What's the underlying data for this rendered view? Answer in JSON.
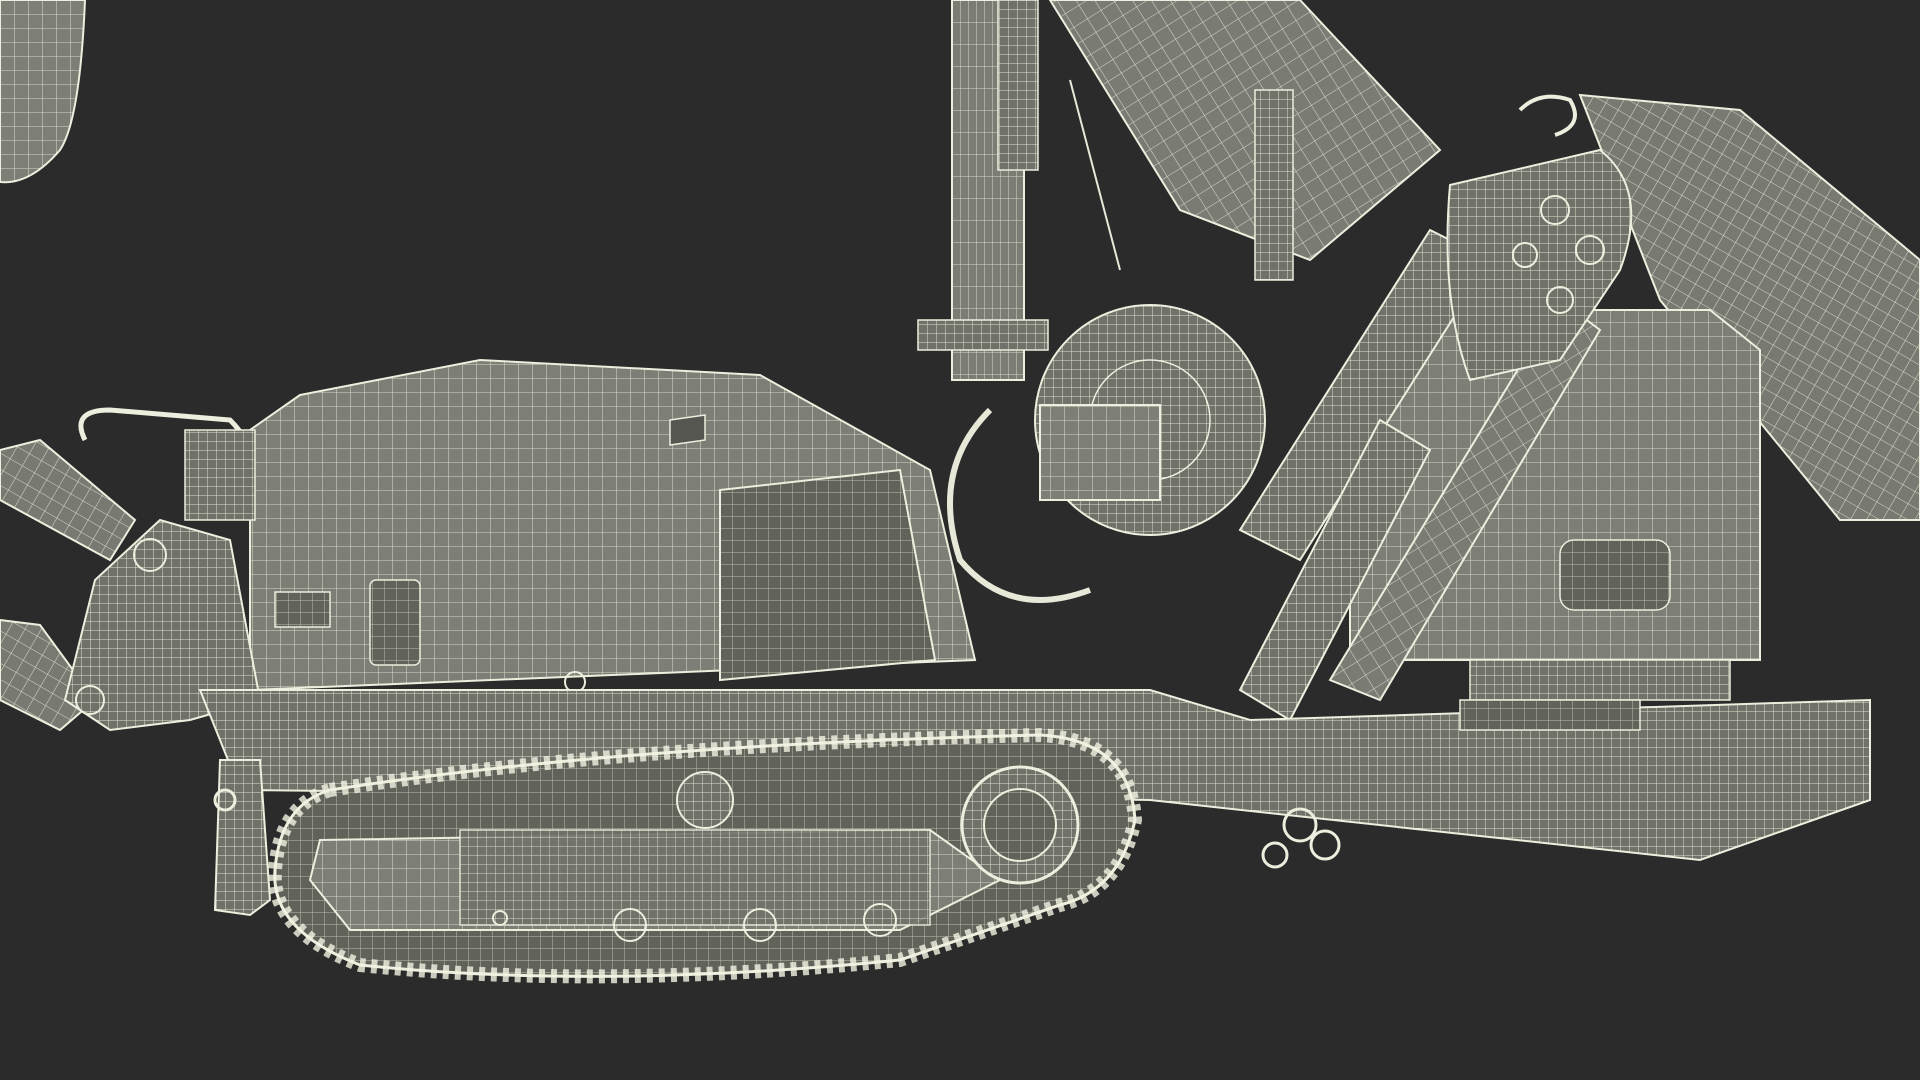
{
  "image": {
    "subject": "wireframe-3d-model",
    "background_color": "#2b2b2b",
    "surface_color": "#7d7e76",
    "surface_shade_color": "#6a6b64",
    "surface_dark_color": "#55564f",
    "wire_color": "#e8e8d8",
    "components": [
      "counterweight-housing",
      "boom",
      "left-arm",
      "crawler-track",
      "drive-sprocket",
      "idler-wheel",
      "hydraulic-cylinders",
      "pivot-plate",
      "hose-reel",
      "mast"
    ]
  }
}
